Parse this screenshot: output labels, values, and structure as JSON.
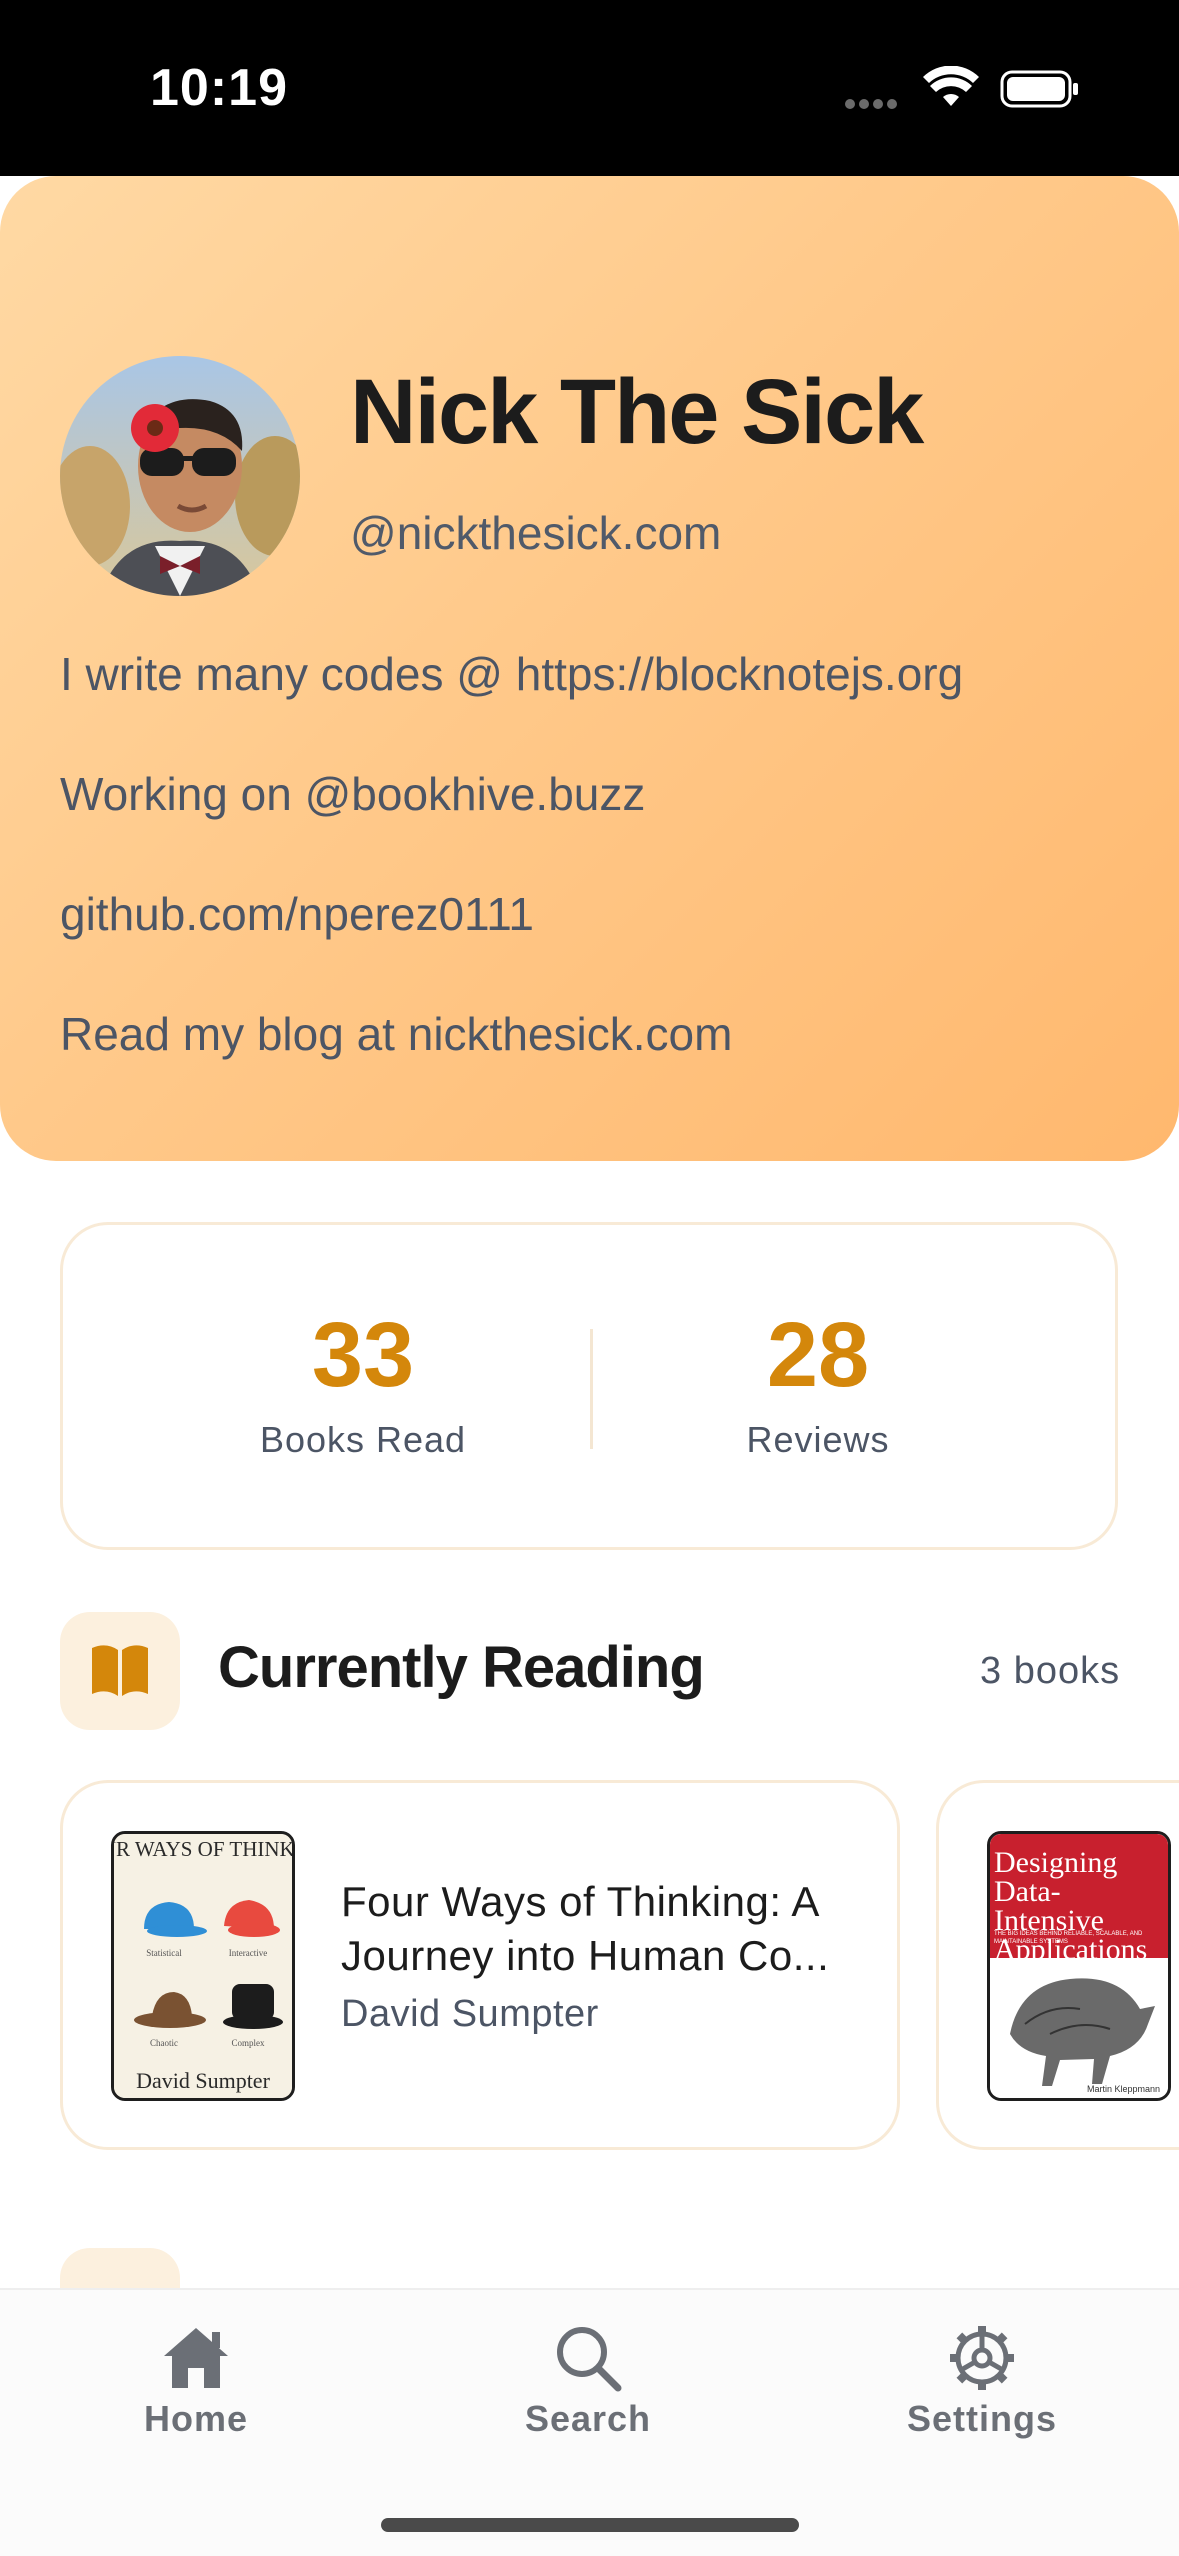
{
  "status_bar": {
    "time": "10:19"
  },
  "profile": {
    "name": "Nick The Sick",
    "handle": "@nickthesick.com",
    "bio": [
      "I write many codes @ https://blocknotejs.org",
      "Working on @bookhive.buzz",
      "github.com/nperez0111",
      "Read my blog at nickthesick.com"
    ]
  },
  "stats": {
    "books_read": {
      "value": "33",
      "label": "Books Read"
    },
    "reviews": {
      "value": "28",
      "label": "Reviews"
    }
  },
  "currently_reading": {
    "title": "Currently Reading",
    "count": "3 books",
    "books": [
      {
        "title": "Four Ways of Thinking: A Journey into Human Co...",
        "author": "David Sumpter",
        "cover_text": {
          "heading": "FOUR WAYS OF THINKING",
          "author": "David Sumpter",
          "labels": [
            "Statistical",
            "Interactive",
            "Chaotic",
            "Complex"
          ]
        }
      },
      {
        "cover_text": {
          "heading": "Designing Data-Intensive Applications",
          "subtitle": "THE BIG IDEAS BEHIND RELIABLE, SCALABLE, AND MAINTAINABLE SYSTEMS",
          "author": "Martin Kleppmann"
        }
      }
    ]
  },
  "tab_bar": {
    "tabs": [
      {
        "label": "Home",
        "icon": "home-icon"
      },
      {
        "label": "Search",
        "icon": "search-icon"
      },
      {
        "label": "Settings",
        "icon": "gear-icon"
      }
    ]
  },
  "colors": {
    "accent": "#d4870b",
    "header_gradient_start": "#ffd9a4",
    "header_gradient_end": "#ffb86e",
    "tab_inactive": "#6b6f76"
  }
}
